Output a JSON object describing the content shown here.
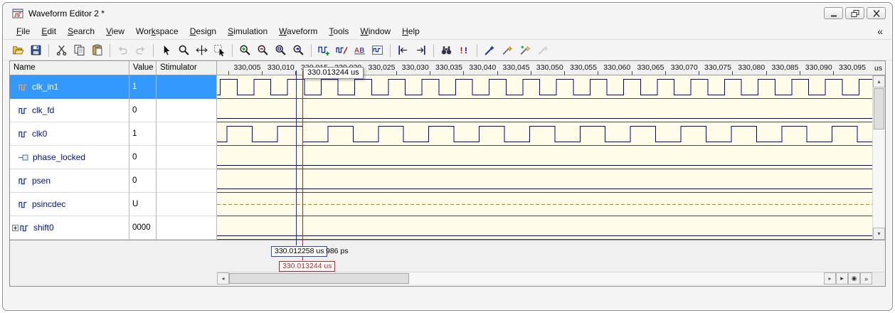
{
  "window": {
    "title": "Waveform Editor 2 *"
  },
  "menu": {
    "items": [
      {
        "label": "File",
        "accel": 0
      },
      {
        "label": "Edit",
        "accel": 0
      },
      {
        "label": "Search",
        "accel": 0
      },
      {
        "label": "View",
        "accel": 0
      },
      {
        "label": "Workspace",
        "accel": 3
      },
      {
        "label": "Design",
        "accel": 0
      },
      {
        "label": "Simulation",
        "accel": 0
      },
      {
        "label": "Waveform",
        "accel": 0
      },
      {
        "label": "Tools",
        "accel": 0
      },
      {
        "label": "Window",
        "accel": 0
      },
      {
        "label": "Help",
        "accel": 0
      }
    ],
    "collapse_glyph": "«"
  },
  "toolbar": {
    "groups": [
      [
        "open",
        "save"
      ],
      [
        "cut",
        "copy",
        "paste"
      ],
      [
        "undo",
        "redo"
      ],
      [
        "select-mode",
        "zoom-mode",
        "time-cursor-mode",
        "drag-mode"
      ],
      [
        "zoom-in",
        "zoom-out",
        "zoom-full",
        "zoom-custom"
      ],
      [
        "add-signals",
        "stimulators",
        "find-letters",
        "compare-signals"
      ],
      [
        "previous-transition",
        "next-transition"
      ],
      [
        "find",
        "show-differences"
      ],
      [
        "annotate-wand",
        "compare-gold",
        "compare-test",
        "compare-off"
      ]
    ],
    "disabled": [
      "undo",
      "redo",
      "compare-off"
    ]
  },
  "table": {
    "columns": [
      "Name",
      "Value",
      "Stimulator"
    ]
  },
  "timeline": {
    "unit": "us",
    "ticks": [
      {
        "t": 330005,
        "label": "330,005"
      },
      {
        "t": 330010,
        "label": "330,010"
      },
      {
        "t": 330015,
        "label": "330,015"
      },
      {
        "t": 330020,
        "label": "330,020"
      },
      {
        "t": 330025,
        "label": "330,025"
      },
      {
        "t": 330030,
        "label": "330,030"
      },
      {
        "t": 330035,
        "label": "330,035"
      },
      {
        "t": 330040,
        "label": "330,040"
      },
      {
        "t": 330045,
        "label": "330,045"
      },
      {
        "t": 330050,
        "label": "330,050"
      },
      {
        "t": 330055,
        "label": "330,055"
      },
      {
        "t": 330060,
        "label": "330,060"
      },
      {
        "t": 330065,
        "label": "330,065"
      },
      {
        "t": 330070,
        "label": "330,070"
      },
      {
        "t": 330075,
        "label": "330,075"
      },
      {
        "t": 330080,
        "label": "330,080"
      },
      {
        "t": 330085,
        "label": "330,085"
      },
      {
        "t": 330090,
        "label": "330,090"
      },
      {
        "t": 330095,
        "label": "330,095"
      }
    ]
  },
  "cursors": {
    "cursor1": {
      "time_ns": 330012.258,
      "label": "330.012258 us"
    },
    "cursor2": {
      "time_ns": 330013.244,
      "label": "330.013244 us"
    },
    "delta_label": "986 ps",
    "tooltip": "330.013244 us"
  },
  "signals": [
    {
      "name": "clk_in1",
      "value": "1",
      "icon": "signal",
      "selected": true,
      "wave": {
        "type": "clock",
        "period_ns": 5,
        "first_rise_ns": 330001,
        "duty": 0.5
      }
    },
    {
      "name": "clk_fd",
      "value": "0",
      "icon": "signal",
      "wave": {
        "type": "flat",
        "level": "low"
      }
    },
    {
      "name": "clk0",
      "value": "1",
      "icon": "signal",
      "wave": {
        "type": "clock",
        "period_ns": 7.5,
        "first_rise_ns": 330002,
        "duty": 0.5
      }
    },
    {
      "name": "phase_locked",
      "value": "0",
      "icon": "port",
      "wave": {
        "type": "flat",
        "level": "low"
      }
    },
    {
      "name": "psen",
      "value": "0",
      "icon": "signal",
      "wave": {
        "type": "flat",
        "level": "low"
      }
    },
    {
      "name": "psincdec",
      "value": "U",
      "icon": "signal",
      "wave": {
        "type": "dashed",
        "color": "#b8860b"
      }
    },
    {
      "name": "shift0",
      "value": "0000",
      "icon": "signal",
      "expandable": true,
      "wave": {
        "type": "flat",
        "level": "low"
      }
    }
  ],
  "colors": {
    "selection": "#3399ff",
    "wave": "#0000a0",
    "wave_bg": "#fffdea",
    "cursor1": "#2222cc",
    "cursor2": "#bb2222",
    "name_text": "#000f86",
    "unknown_wave": "#b8860b"
  }
}
